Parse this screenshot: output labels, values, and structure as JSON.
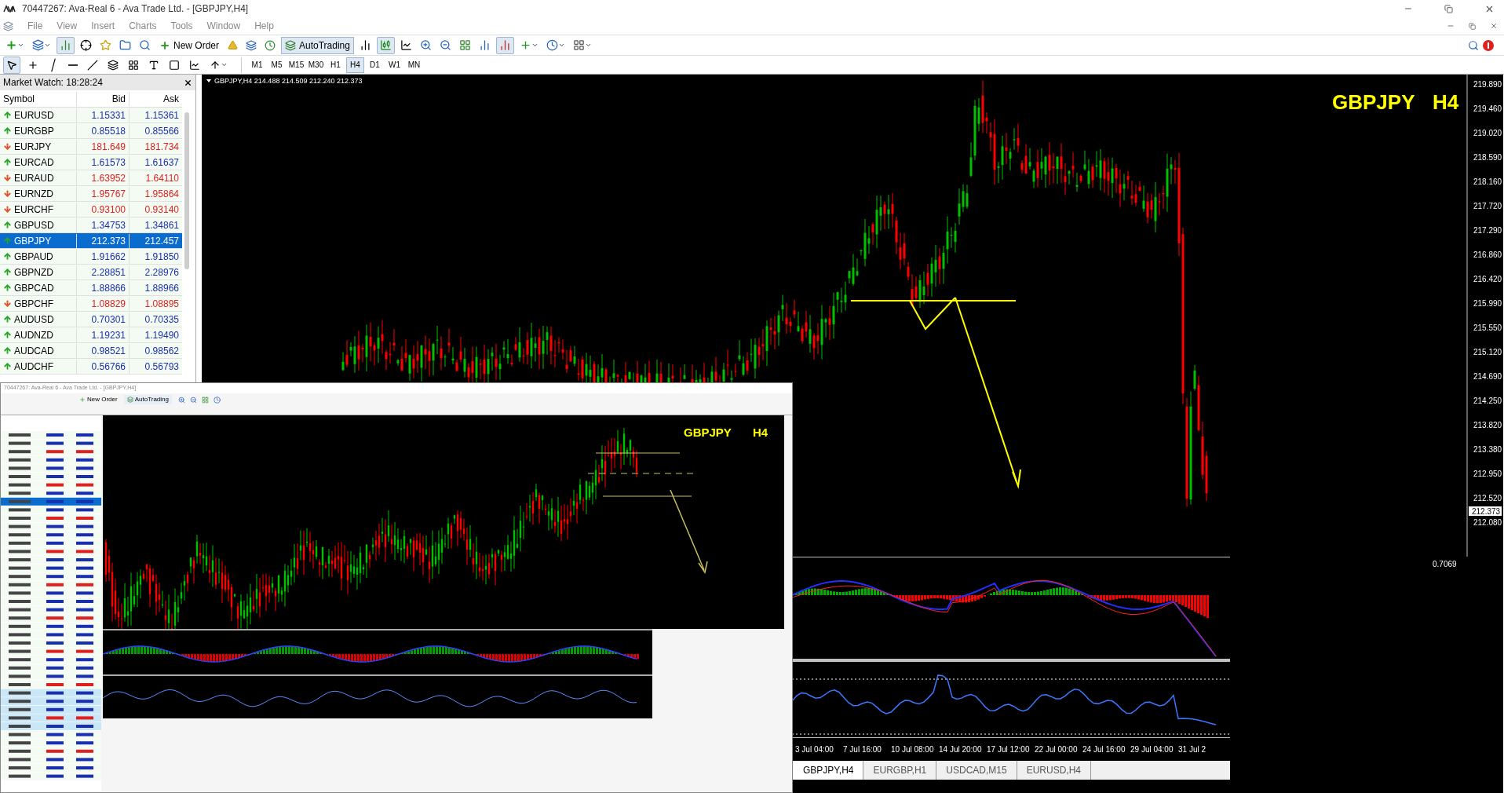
{
  "window": {
    "title": "70447267: Ava-Real 6 - Ava Trade Ltd. - [GBPJPY,H4]",
    "menu": [
      "File",
      "View",
      "Insert",
      "Charts",
      "Tools",
      "Window",
      "Help"
    ]
  },
  "toolbar": {
    "new_order": "New Order",
    "auto_trading": "AutoTrading",
    "timeframes": [
      {
        "label": "M1",
        "selected": false
      },
      {
        "label": "M5",
        "selected": false
      },
      {
        "label": "M15",
        "selected": false
      },
      {
        "label": "M30",
        "selected": false
      },
      {
        "label": "H1",
        "selected": false
      },
      {
        "label": "H4",
        "selected": true
      },
      {
        "label": "D1",
        "selected": false
      },
      {
        "label": "W1",
        "selected": false
      },
      {
        "label": "MN",
        "selected": false
      }
    ]
  },
  "market_watch": {
    "title": "Market Watch: 18:28:24",
    "columns": [
      "Symbol",
      "Bid",
      "Ask"
    ],
    "rows": [
      {
        "symbol": "EURUSD",
        "bid": "1.15331",
        "ask": "1.15361",
        "kind": "up",
        "selected": false
      },
      {
        "symbol": "EURGBP",
        "bid": "0.85518",
        "ask": "0.85566",
        "kind": "up",
        "selected": false
      },
      {
        "symbol": "EURJPY",
        "bid": "181.649",
        "ask": "181.734",
        "kind": "down",
        "selected": false
      },
      {
        "symbol": "EURCAD",
        "bid": "1.61573",
        "ask": "1.61637",
        "kind": "up",
        "selected": false
      },
      {
        "symbol": "EURAUD",
        "bid": "1.63952",
        "ask": "1.64110",
        "kind": "down",
        "selected": false
      },
      {
        "symbol": "EURNZD",
        "bid": "1.95767",
        "ask": "1.95864",
        "kind": "down",
        "selected": false
      },
      {
        "symbol": "EURCHF",
        "bid": "0.93100",
        "ask": "0.93140",
        "kind": "down",
        "selected": false
      },
      {
        "symbol": "GBPUSD",
        "bid": "1.34753",
        "ask": "1.34861",
        "kind": "up",
        "selected": false
      },
      {
        "symbol": "GBPJPY",
        "bid": "212.373",
        "ask": "212.457",
        "kind": "up",
        "selected": true
      },
      {
        "symbol": "GBPAUD",
        "bid": "1.91662",
        "ask": "1.91850",
        "kind": "up",
        "selected": false
      },
      {
        "symbol": "GBPNZD",
        "bid": "2.28851",
        "ask": "2.28976",
        "kind": "up",
        "selected": false
      },
      {
        "symbol": "GBPCAD",
        "bid": "1.88866",
        "ask": "1.88966",
        "kind": "up",
        "selected": false
      },
      {
        "symbol": "GBPCHF",
        "bid": "1.08829",
        "ask": "1.08895",
        "kind": "down",
        "selected": false
      },
      {
        "symbol": "AUDUSD",
        "bid": "0.70301",
        "ask": "0.70335",
        "kind": "up",
        "selected": false
      },
      {
        "symbol": "AUDNZD",
        "bid": "1.19231",
        "ask": "1.19490",
        "kind": "up",
        "selected": false
      },
      {
        "symbol": "AUDCAD",
        "bid": "0.98521",
        "ask": "0.98562",
        "kind": "up",
        "selected": false
      },
      {
        "symbol": "AUDCHF",
        "bid": "0.56766",
        "ask": "0.56793",
        "kind": "up",
        "selected": false
      }
    ]
  },
  "chart": {
    "header": "GBPJPY,H4 214.488 214.509 212.240 212.373",
    "symbol_label": "GBPJPY",
    "period_label": "H4",
    "price_axis": [
      "219.890",
      "219.460",
      "219.020",
      "218.590",
      "218.160",
      "217.720",
      "217.290",
      "216.860",
      "216.420",
      "215.990",
      "215.550",
      "215.120",
      "214.690",
      "214.250",
      "213.820",
      "213.380",
      "212.950",
      "212.520",
      "212.080"
    ],
    "current_price": "212.373",
    "indicator_value": "0.7069",
    "time_axis": [
      "3 Jul 04:00",
      "7 Jul 16:00",
      "10 Jul 08:00",
      "14 Jul 20:00",
      "17 Jul 12:00",
      "22 Jul 00:00",
      "24 Jul 16:00",
      "29 Jul 04:00",
      "31 Jul 2"
    ]
  },
  "chart_tabs": [
    {
      "label": "GBPJPY,H4",
      "selected": true
    },
    {
      "label": "EURGBP,H1",
      "selected": false
    },
    {
      "label": "USDCAD,M15",
      "selected": false
    },
    {
      "label": "EURUSD,H4",
      "selected": false
    }
  ],
  "inset": {
    "title": "70447267: Ava-Real 6 - Ava Trade Ltd. - [GBPJPY,H4]",
    "new_order": "New Order",
    "auto_trading": "AutoTrading",
    "symbol_label": "GBPJPY",
    "period_label": "H4"
  }
}
